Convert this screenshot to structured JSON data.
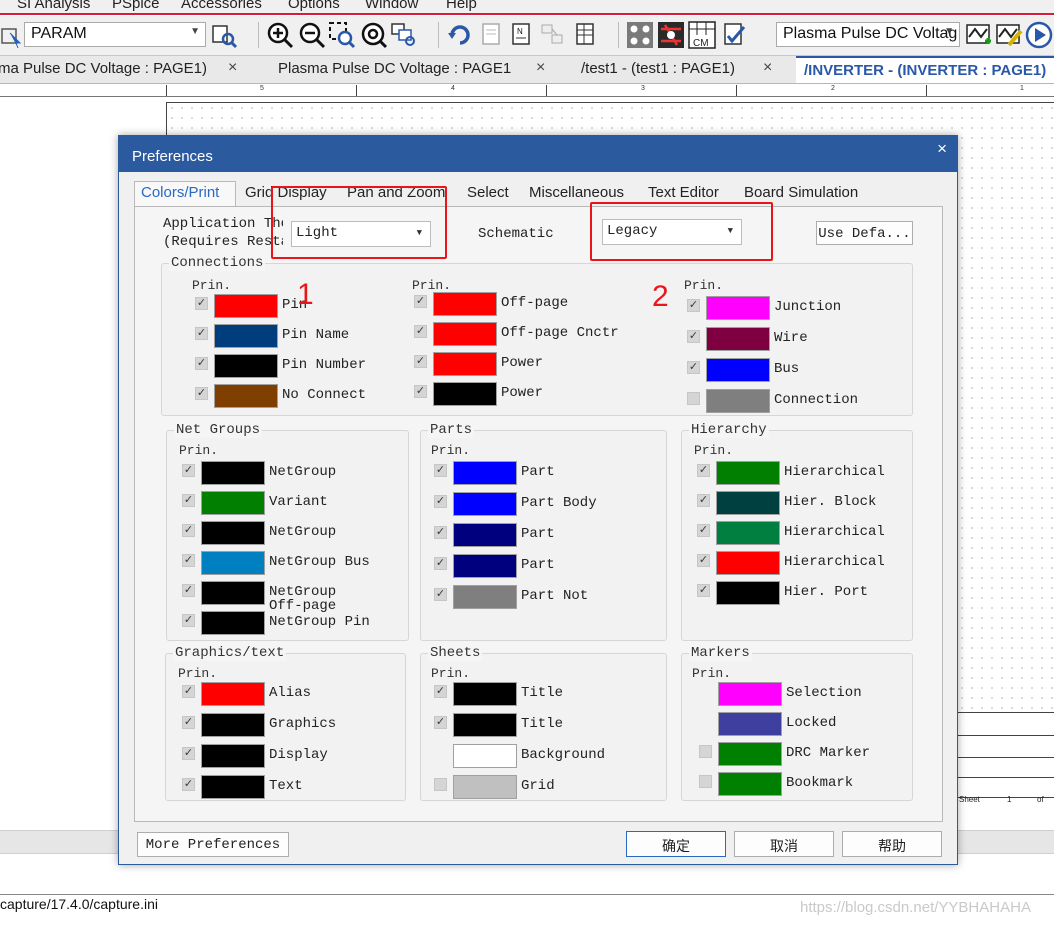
{
  "menu": [
    "SI Analysis",
    "PSpice",
    "Accessories",
    "Options",
    "Window",
    "Help"
  ],
  "toolbar": {
    "param_combo": "PARAM",
    "profile_combo": "Plasma Pulse DC Voltag",
    "icons": [
      "select-arrow-icon",
      "find-icon",
      "zoom-in-icon",
      "zoom-out-icon",
      "zoom-area-icon",
      "zoom-all-icon",
      "zoom-fit-icon",
      "refresh-icon",
      "netlist-icon",
      "annotate-icon",
      "bom-icon",
      "grid-dots-icon",
      "snap-toggle-icon",
      "cm-grid-icon",
      "check-icon",
      "sim-settings-icon",
      "sim-marker-icon",
      "run-icon"
    ]
  },
  "tabs": [
    {
      "label": "ma Pulse DC Voltage : PAGE1)",
      "close": "×"
    },
    {
      "label": "Plasma Pulse DC Voltage : PAGE1",
      "close": "×"
    },
    {
      "label": "/test1 - (test1 : PAGE1)",
      "close": "×"
    },
    {
      "label": "/INVERTER - (INVERTER : PAGE1)",
      "close": ""
    }
  ],
  "ruler_numbers": [
    "5",
    "4",
    "3",
    "2",
    "1"
  ],
  "sheet_labels": {
    "sheet": "Sheet",
    "page": "1",
    "of": "of"
  },
  "dialog": {
    "title": "Preferences",
    "close": "×",
    "tabs": [
      "Colors/Print",
      "Grid Display",
      "Pan and Zoom",
      "Select",
      "Miscellaneous",
      "Text Editor",
      "Board Simulation"
    ],
    "app_theme_label_1": "Application The",
    "app_theme_label_2": "(Requires Resta",
    "app_theme_value": "Light",
    "schematic_label": "Schematic",
    "schematic_value": "Legacy",
    "use_defaults": "Use Defa...",
    "prin": "Prin.",
    "groups": {
      "connections": {
        "title": "Connections",
        "col1": [
          {
            "color": "#ff0000",
            "label": "Pin",
            "checked": true
          },
          {
            "color": "#003d7d",
            "label": "Pin Name",
            "checked": true
          },
          {
            "color": "#000000",
            "label": "Pin Number",
            "checked": true
          },
          {
            "color": "#7f3f00",
            "label": "No Connect",
            "checked": true
          }
        ],
        "col2": [
          {
            "color": "#ff0000",
            "label": "Off-page",
            "checked": true
          },
          {
            "color": "#ff0000",
            "label": "Off-page Cnctr",
            "checked": true
          },
          {
            "color": "#ff0000",
            "label": "Power",
            "checked": true
          },
          {
            "color": "#000000",
            "label": "Power",
            "checked": true
          }
        ],
        "col3": [
          {
            "color": "#ff00ff",
            "label": "Junction",
            "checked": true
          },
          {
            "color": "#7f0040",
            "label": "Wire",
            "checked": true
          },
          {
            "color": "#0000ff",
            "label": "Bus",
            "checked": true
          },
          {
            "color": "#7f7f7f",
            "label": "Connection",
            "checked": false
          }
        ]
      },
      "net_groups": {
        "title": "Net Groups",
        "items": [
          {
            "color": "#000000",
            "label": "NetGroup",
            "checked": true
          },
          {
            "color": "#007f00",
            "label": "Variant",
            "checked": true
          },
          {
            "color": "#000000",
            "label": "NetGroup",
            "checked": true
          },
          {
            "color": "#0080c0",
            "label": "NetGroup Bus",
            "checked": true
          },
          {
            "color": "#000000",
            "label": "NetGroup",
            "label2": "Off-page",
            "checked": true
          },
          {
            "color": "#000000",
            "label": "NetGroup Pin",
            "checked": true
          }
        ]
      },
      "parts": {
        "title": "Parts",
        "items": [
          {
            "color": "#0000ff",
            "label": "Part",
            "checked": true
          },
          {
            "color": "#0000ff",
            "label": "Part Body",
            "checked": true
          },
          {
            "color": "#00007f",
            "label": "Part",
            "checked": true
          },
          {
            "color": "#00007f",
            "label": "Part",
            "checked": true
          },
          {
            "color": "#7f7f7f",
            "label": "Part Not",
            "checked": true
          }
        ]
      },
      "hierarchy": {
        "title": "Hierarchy",
        "items": [
          {
            "color": "#007f00",
            "label": "Hierarchical",
            "checked": true
          },
          {
            "color": "#004040",
            "label": "Hier. Block",
            "checked": true
          },
          {
            "color": "#007f40",
            "label": "Hierarchical",
            "checked": true
          },
          {
            "color": "#ff0000",
            "label": "Hierarchical",
            "checked": true
          },
          {
            "color": "#000000",
            "label": "Hier. Port",
            "checked": true
          }
        ]
      },
      "graphics_text": {
        "title": "Graphics/text",
        "items": [
          {
            "color": "#ff0000",
            "label": "Alias",
            "checked": true
          },
          {
            "color": "#000000",
            "label": "Graphics",
            "checked": true
          },
          {
            "color": "#000000",
            "label": "Display",
            "checked": true
          },
          {
            "color": "#000000",
            "label": "Text",
            "checked": true
          }
        ]
      },
      "sheets": {
        "title": "Sheets",
        "items": [
          {
            "color": "#000000",
            "label": "Title",
            "checked": true
          },
          {
            "color": "#000000",
            "label": "Title",
            "checked": true
          },
          {
            "color": "#ffffff",
            "label": "Background",
            "checked": null
          },
          {
            "color": "#c0c0c0",
            "label": "Grid",
            "checked": false
          }
        ]
      },
      "markers": {
        "title": "Markers",
        "items": [
          {
            "color": "#ff00ff",
            "label": "Selection",
            "checked": null
          },
          {
            "color": "#3f3f9f",
            "label": "Locked",
            "checked": null
          },
          {
            "color": "#008000",
            "label": "DRC Marker",
            "checked": false
          },
          {
            "color": "#008000",
            "label": "Bookmark",
            "checked": false
          }
        ]
      }
    },
    "buttons": {
      "more": "More Preferences",
      "ok": "确定",
      "cancel": "取消",
      "help": "帮助"
    }
  },
  "annotations": [
    "1",
    "2"
  ],
  "status": {
    "path": "capture/17.4.0/capture.ini",
    "watermark": "https://blog.csdn.net/YYBHAHAHA"
  }
}
